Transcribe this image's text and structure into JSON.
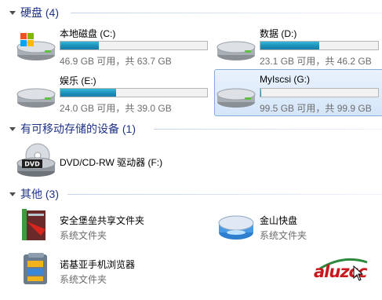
{
  "groups": {
    "hard_disks": {
      "label": "硬盘 (4)"
    },
    "removable": {
      "label": "有可移动存储的设备 (1)"
    },
    "other": {
      "label": "其他 (3)"
    }
  },
  "drives": [
    {
      "name": "本地磁盘 (C:)",
      "space": "46.9 GB 可用，共 63.7 GB",
      "used_fraction": 0.26,
      "has_windows_logo": true
    },
    {
      "name": "数据 (D:)",
      "space": "23.1 GB 可用，共 46.2 GB",
      "used_fraction": 0.5
    },
    {
      "name": "娱乐 (E:)",
      "space": "24.0 GB 可用，共 39.0 GB",
      "used_fraction": 0.38
    },
    {
      "name": "MyIscsi (G:)",
      "space": "99.5 GB 可用，共 99.9 GB",
      "used_fraction": 0.004,
      "selected": true
    }
  ],
  "removable_devices": [
    {
      "name": "DVD/CD-RW 驱动器 (F:)",
      "icon_label": "DVD"
    }
  ],
  "other_items": [
    {
      "name": "安全堡垒共享文件夹",
      "type": "系统文件夹"
    },
    {
      "name": "金山快盘",
      "type": "系统文件夹"
    },
    {
      "name": "诺基亚手机浏览器",
      "type": "系统文件夹"
    }
  ],
  "watermark": {
    "text": "aluzcc"
  },
  "colors": {
    "group_header": "#1e3287",
    "bar_fill": "#1a8cb8",
    "selection_bg": "#d5e6f9",
    "selection_border": "#84acdd"
  }
}
